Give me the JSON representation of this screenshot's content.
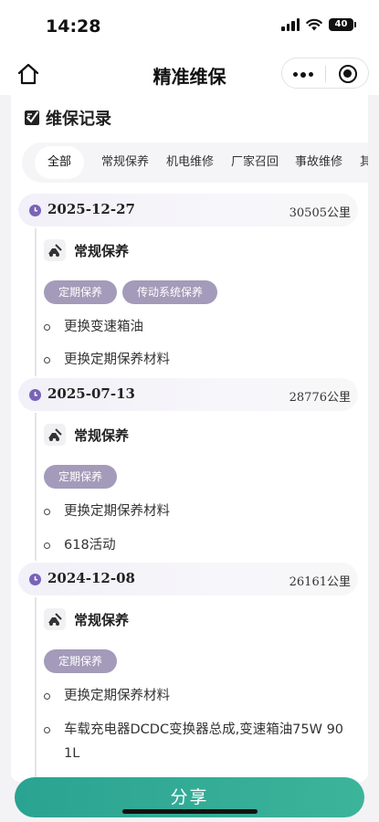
{
  "status_bar": {
    "time": "14:28",
    "battery": "40"
  },
  "nav": {
    "title": "精准维保"
  },
  "section": {
    "title": "维保记录"
  },
  "tabs": [
    {
      "label": "全部",
      "active": true
    },
    {
      "label": "常规保养"
    },
    {
      "label": "机电维修"
    },
    {
      "label": "厂家召回"
    },
    {
      "label": "事故维修"
    },
    {
      "label": "其"
    }
  ],
  "records": [
    {
      "date": "2025-12-27",
      "mileage": "30505公里",
      "type": "常规保养",
      "tags": [
        "定期保养",
        "传动系统保养"
      ],
      "items": [
        "更换变速箱油",
        "更换定期保养材料"
      ]
    },
    {
      "date": "2025-07-13",
      "mileage": "28776公里",
      "type": "常规保养",
      "tags": [
        "定期保养"
      ],
      "items": [
        "更换定期保养材料",
        "618活动"
      ]
    },
    {
      "date": "2024-12-08",
      "mileage": "26161公里",
      "type": "常规保养",
      "tags": [
        "定期保养"
      ],
      "items": [
        "更换定期保养材料",
        "车载充电器DCDC变换器总成,变速箱油75W 90 1L"
      ]
    }
  ],
  "share_button": {
    "label": "分享"
  },
  "colors": {
    "accent": "#2aa392",
    "tag": "#a39bb9",
    "clock": "#7a62b8"
  }
}
